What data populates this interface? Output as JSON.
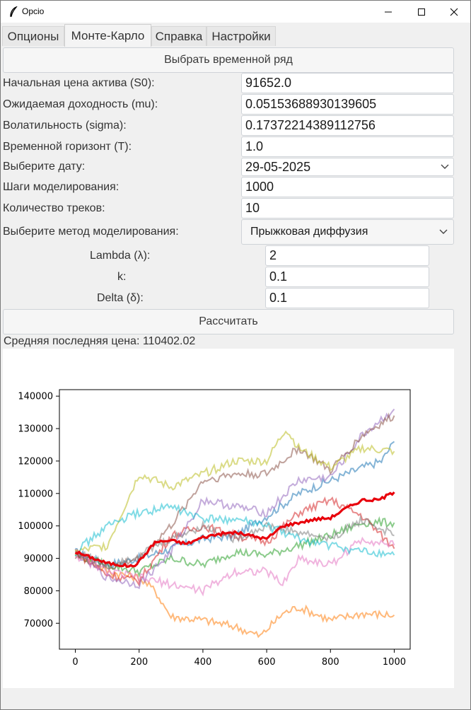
{
  "window": {
    "title": "Opcio",
    "icon": "feather-icon",
    "controls": [
      "minimize-icon",
      "maximize-icon",
      "close-icon"
    ]
  },
  "tabs": [
    {
      "label": "Опционы",
      "active": false
    },
    {
      "label": "Монте-Карло",
      "active": true
    },
    {
      "label": "Справка",
      "active": false
    },
    {
      "label": "Настройки",
      "active": false
    }
  ],
  "form": {
    "select_series_button": "Выбрать временной ряд",
    "fields": [
      {
        "label": "Начальная цена актива (S0):",
        "value": "91652.0"
      },
      {
        "label": "Ожидаемая доходность (mu):",
        "value": "0.05153688930139605"
      },
      {
        "label": "Волатильность (sigma):",
        "value": "0.17372214389112756"
      },
      {
        "label": "Временной горизонт (T):",
        "value": "1.0"
      }
    ],
    "date": {
      "label": "Выберите дату:",
      "value": "29-05-2025"
    },
    "steps": {
      "label": "Шаги моделирования:",
      "value": "1000"
    },
    "tracks": {
      "label": "Количество треков:",
      "value": "10"
    },
    "method": {
      "label": "Выберите метод моделирования:",
      "value": "Прыжковая диффузия"
    },
    "jump_params": [
      {
        "label": "Lambda (λ):",
        "value": "2"
      },
      {
        "label": "k:",
        "value": "0.1"
      },
      {
        "label": "Delta (δ):",
        "value": "0.1"
      }
    ],
    "calculate_button": "Рассчитать",
    "result_text": "Средняя последняя цена: 110402.02"
  },
  "chart_data": {
    "type": "line",
    "title": "",
    "xlabel": "",
    "ylabel": "",
    "xlim": [
      -50,
      1050
    ],
    "ylim": [
      62000,
      142000
    ],
    "xticks": [
      0,
      200,
      400,
      600,
      800,
      1000
    ],
    "yticks": [
      70000,
      80000,
      90000,
      100000,
      110000,
      120000,
      130000,
      140000
    ],
    "series": [
      {
        "color": "#1f77b4",
        "values": [
          [
            0,
            92000
          ],
          [
            100,
            88000
          ],
          [
            200,
            90000
          ],
          [
            300,
            93000
          ],
          [
            400,
            96000
          ],
          [
            500,
            97000
          ],
          [
            600,
            103000
          ],
          [
            700,
            110000
          ],
          [
            800,
            114000
          ],
          [
            900,
            118000
          ],
          [
            960,
            120000
          ],
          [
            1000,
            126000
          ]
        ]
      },
      {
        "color": "#ff7f0e",
        "values": [
          [
            0,
            92000
          ],
          [
            100,
            86000
          ],
          [
            200,
            84000
          ],
          [
            250,
            80000
          ],
          [
            300,
            72000
          ],
          [
            400,
            71000
          ],
          [
            500,
            69000
          ],
          [
            580,
            66000
          ],
          [
            650,
            73000
          ],
          [
            700,
            75000
          ],
          [
            800,
            71000
          ],
          [
            900,
            73000
          ],
          [
            1000,
            72500
          ]
        ]
      },
      {
        "color": "#2ca02c",
        "values": [
          [
            0,
            91000
          ],
          [
            100,
            88000
          ],
          [
            200,
            86000
          ],
          [
            300,
            90000
          ],
          [
            400,
            88000
          ],
          [
            500,
            92000
          ],
          [
            600,
            91000
          ],
          [
            700,
            94000
          ],
          [
            800,
            97000
          ],
          [
            900,
            101000
          ],
          [
            1000,
            101000
          ]
        ]
      },
      {
        "color": "#d62728",
        "values": [
          [
            0,
            92000
          ],
          [
            100,
            85000
          ],
          [
            200,
            83000
          ],
          [
            300,
            97000
          ],
          [
            400,
            100000
          ],
          [
            500,
            97000
          ],
          [
            600,
            95000
          ],
          [
            700,
            104000
          ],
          [
            800,
            108000
          ],
          [
            900,
            103000
          ],
          [
            1000,
            93000
          ]
        ]
      },
      {
        "color": "#9467bd",
        "values": [
          [
            0,
            92000
          ],
          [
            100,
            84000
          ],
          [
            200,
            82000
          ],
          [
            300,
            92000
          ],
          [
            400,
            108000
          ],
          [
            500,
            106000
          ],
          [
            600,
            104000
          ],
          [
            700,
            114000
          ],
          [
            800,
            115000
          ],
          [
            900,
            128000
          ],
          [
            1000,
            136000
          ]
        ]
      },
      {
        "color": "#8c564b",
        "values": [
          [
            0,
            91000
          ],
          [
            100,
            87000
          ],
          [
            200,
            90000
          ],
          [
            300,
            100000
          ],
          [
            400,
            114000
          ],
          [
            500,
            116000
          ],
          [
            600,
            116000
          ],
          [
            700,
            124000
          ],
          [
            800,
            117000
          ],
          [
            900,
            128000
          ],
          [
            1000,
            134000
          ]
        ]
      },
      {
        "color": "#e377c2",
        "values": [
          [
            0,
            91000
          ],
          [
            100,
            86000
          ],
          [
            200,
            84000
          ],
          [
            300,
            82000
          ],
          [
            400,
            80000
          ],
          [
            500,
            86000
          ],
          [
            600,
            86000
          ],
          [
            650,
            82000
          ],
          [
            700,
            90000
          ],
          [
            800,
            88000
          ],
          [
            900,
            96000
          ],
          [
            1000,
            94000
          ]
        ]
      },
      {
        "color": "#7f7f7f",
        "values": [
          [
            0,
            92000
          ],
          [
            100,
            88000
          ],
          [
            200,
            91000
          ],
          [
            300,
            96000
          ],
          [
            400,
            100000
          ],
          [
            500,
            96000
          ],
          [
            600,
            100000
          ],
          [
            700,
            98000
          ],
          [
            800,
            96000
          ],
          [
            900,
            102000
          ],
          [
            1000,
            97000
          ]
        ]
      },
      {
        "color": "#bcbd22",
        "values": [
          [
            0,
            92000
          ],
          [
            100,
            94000
          ],
          [
            200,
            116000
          ],
          [
            300,
            112000
          ],
          [
            400,
            116000
          ],
          [
            500,
            120000
          ],
          [
            600,
            120000
          ],
          [
            660,
            130000
          ],
          [
            700,
            124000
          ],
          [
            800,
            118000
          ],
          [
            900,
            124000
          ],
          [
            1000,
            123000
          ]
        ]
      },
      {
        "color": "#17becf",
        "values": [
          [
            0,
            92000
          ],
          [
            100,
            100000
          ],
          [
            200,
            104000
          ],
          [
            300,
            106000
          ],
          [
            400,
            102000
          ],
          [
            500,
            102000
          ],
          [
            600,
            100000
          ],
          [
            700,
            96000
          ],
          [
            800,
            94000
          ],
          [
            900,
            92000
          ],
          [
            1000,
            91000
          ]
        ]
      }
    ],
    "mean_series": {
      "color": "#e8000b",
      "values": [
        [
          0,
          92000
        ],
        [
          100,
          88500
        ],
        [
          180,
          87500
        ],
        [
          200,
          89000
        ],
        [
          250,
          95000
        ],
        [
          300,
          95500
        ],
        [
          350,
          94500
        ],
        [
          400,
          96500
        ],
        [
          450,
          97500
        ],
        [
          500,
          98000
        ],
        [
          550,
          97000
        ],
        [
          600,
          96000
        ],
        [
          650,
          100000
        ],
        [
          700,
          101000
        ],
        [
          750,
          102000
        ],
        [
          800,
          102500
        ],
        [
          850,
          105500
        ],
        [
          900,
          108000
        ],
        [
          950,
          108000
        ],
        [
          1000,
          110400
        ]
      ]
    }
  }
}
